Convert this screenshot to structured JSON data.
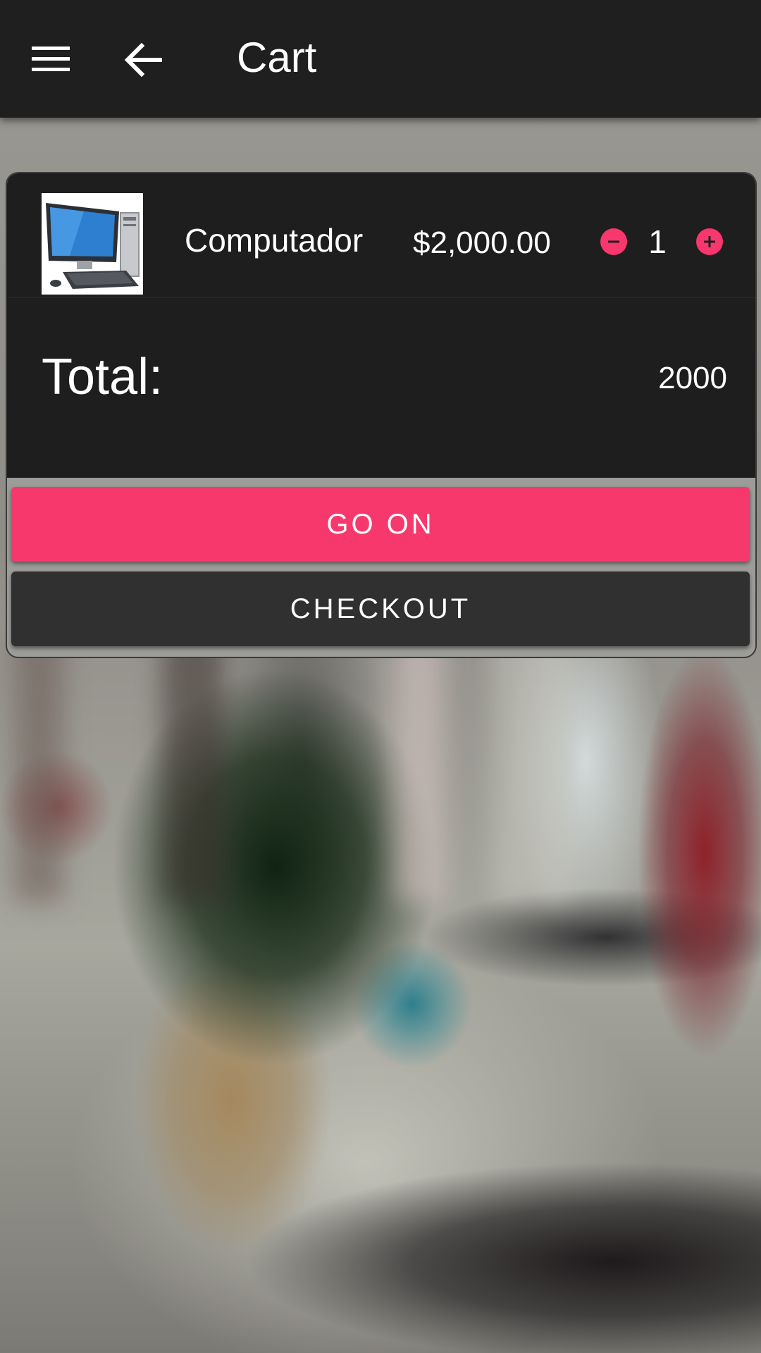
{
  "header": {
    "title": "Cart",
    "menu_icon": "menu-icon",
    "back_icon": "arrow-left-icon"
  },
  "cart": {
    "items": [
      {
        "name": "Computador",
        "price": "$2,000.00",
        "quantity": "1",
        "image_icon": "computer-thumbnail"
      }
    ],
    "total_label": "Total:",
    "total_value": "2000"
  },
  "actions": {
    "go_on_label": "GO ON",
    "checkout_label": "CHECKOUT"
  },
  "colors": {
    "accent": "#f7386d",
    "bar": "#1f1f1f",
    "card": "#1e1e1f",
    "secondary_button": "#303030"
  }
}
